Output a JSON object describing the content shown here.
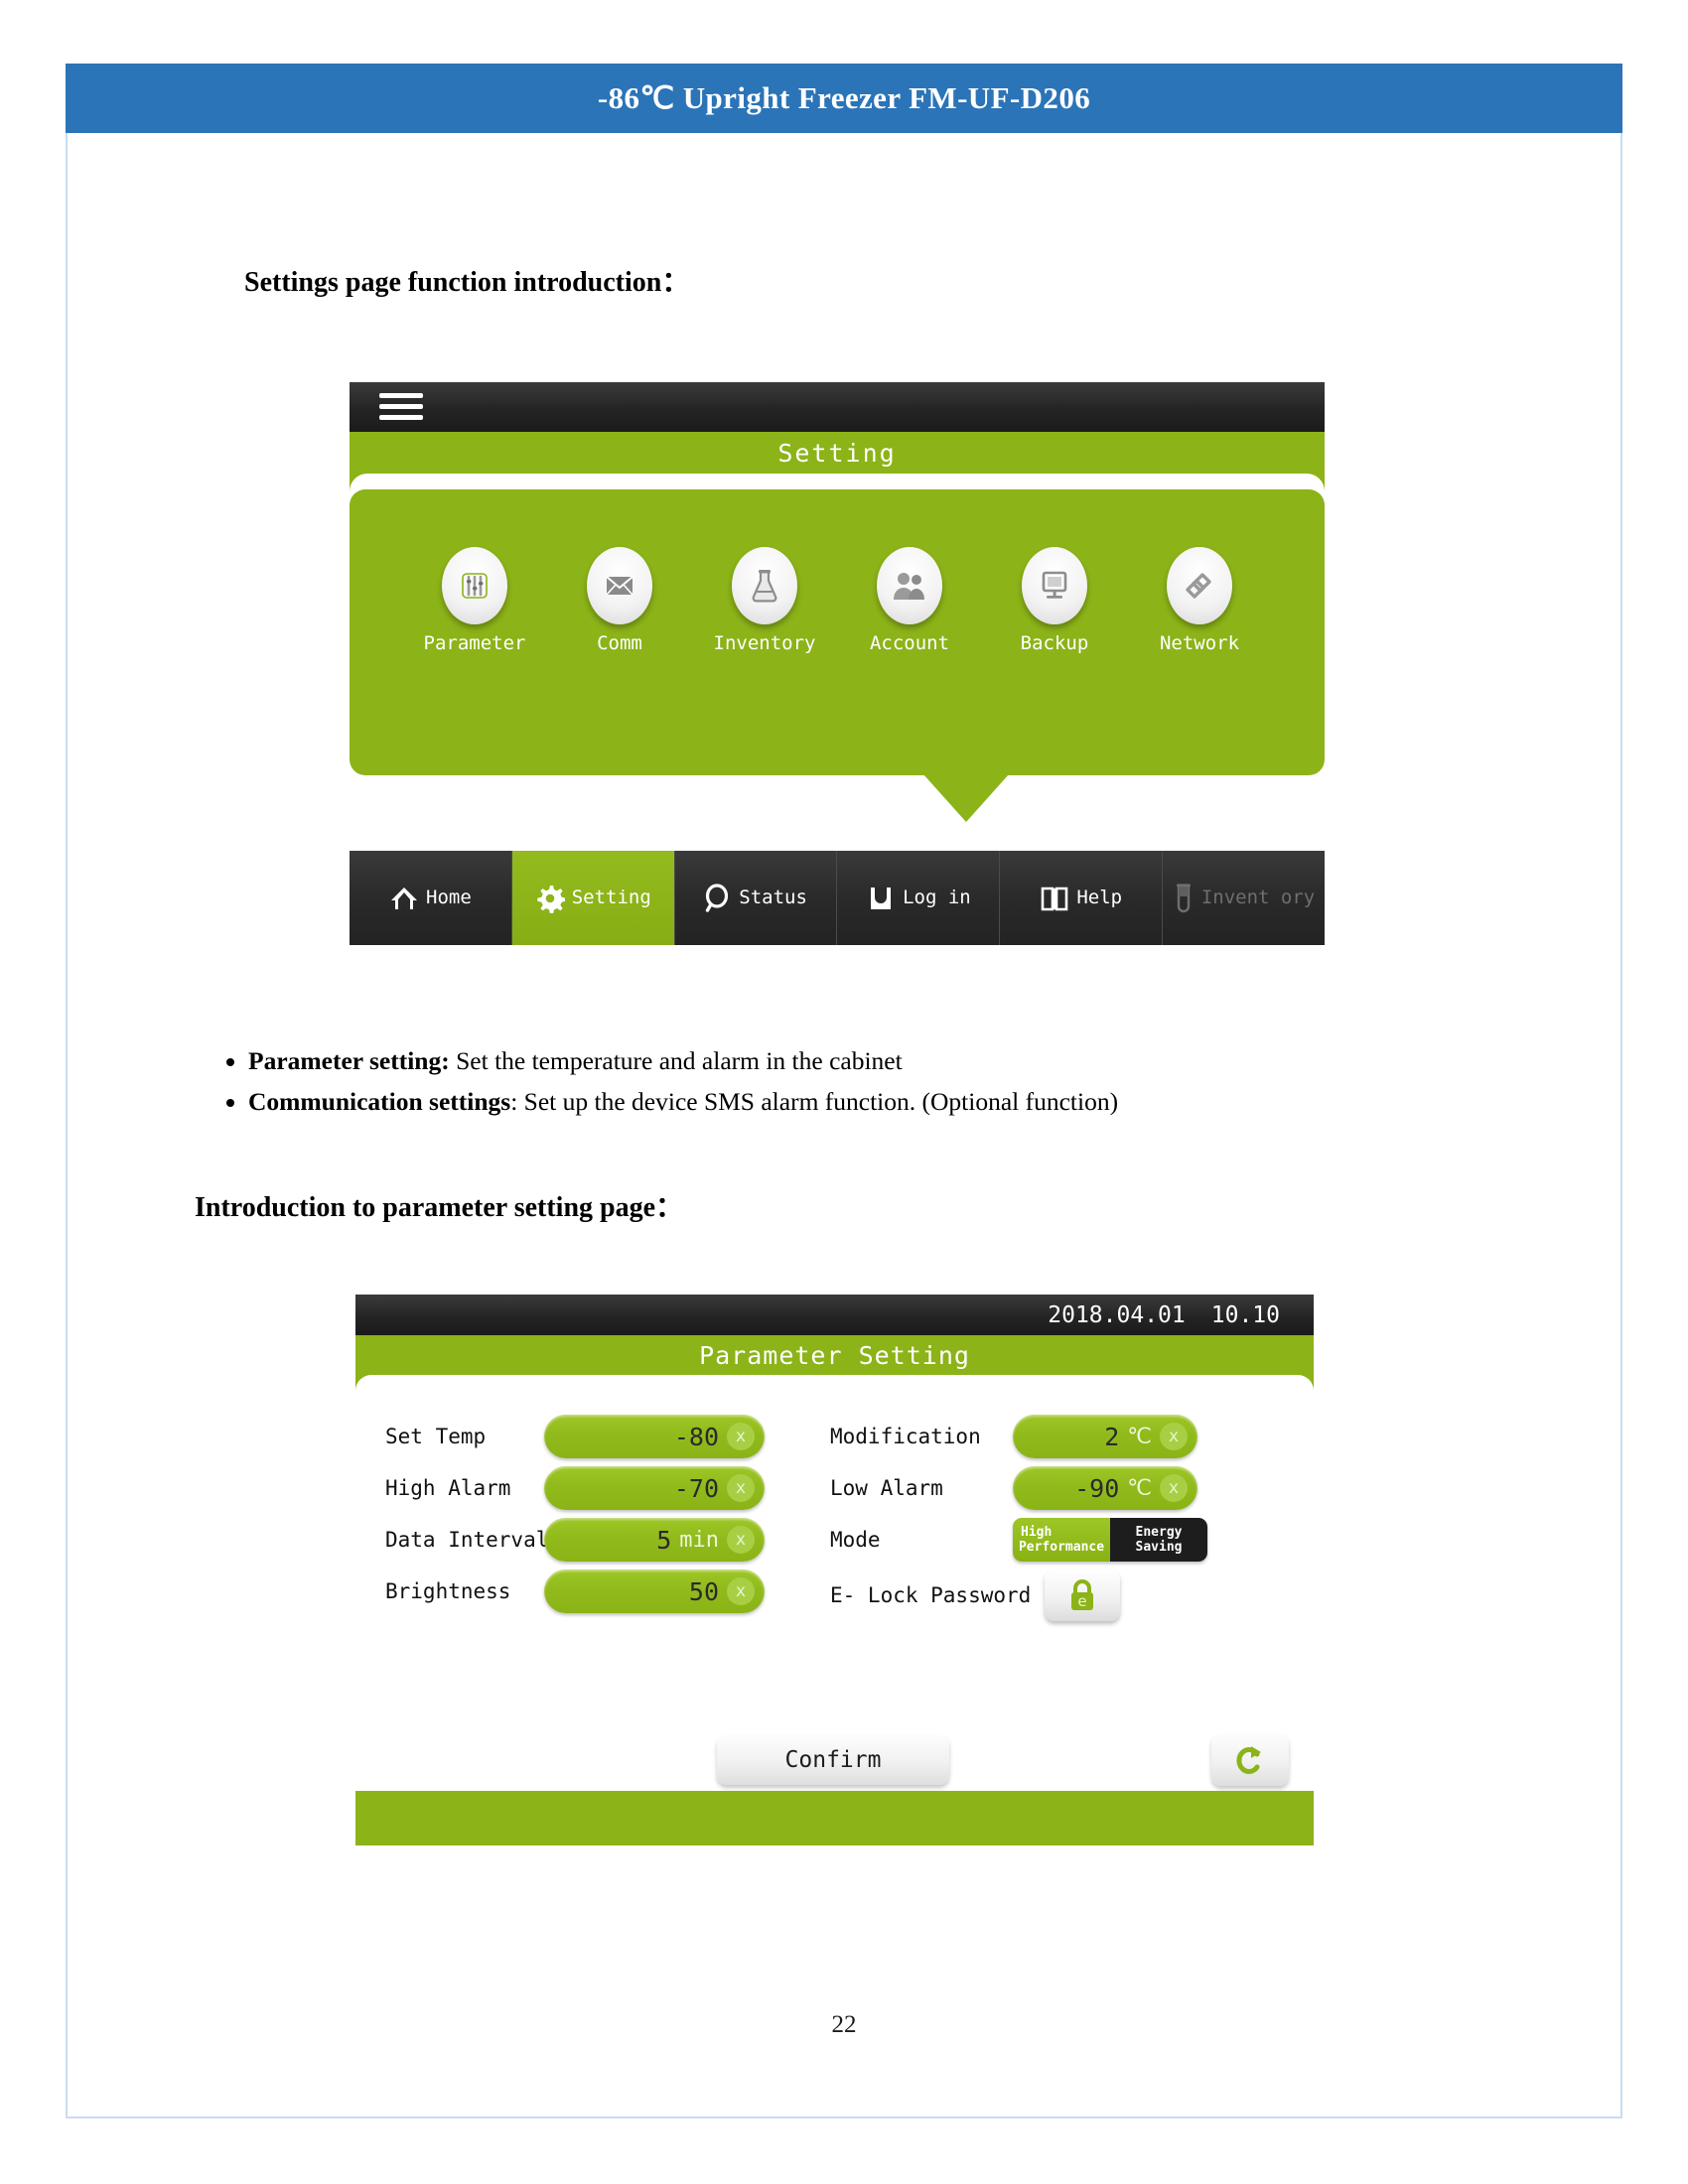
{
  "banner": {
    "title": "-86℃ Upright Freezer FM-UF-D206"
  },
  "headings": {
    "settings_intro": "Settings page function introduction：",
    "parameter_intro": "Introduction to parameter setting page："
  },
  "bullets": [
    {
      "term": "Parameter setting:",
      "desc": " Set the temperature and alarm in the cabinet"
    },
    {
      "term": "Communication settings",
      "desc": ": Set up the device SMS alarm function. (Optional function)"
    }
  ],
  "page_number": "22",
  "colors": {
    "banner_blue": "#2b74b8",
    "accent_green": "#8cb318",
    "dark_bar": "#242424",
    "border_blue": "#c9dcf0"
  },
  "setting_screen": {
    "menu_icon": "hamburger-icon",
    "title": "Setting",
    "tiles": [
      {
        "label": "Parameter",
        "icon": "sliders-icon"
      },
      {
        "label": "Comm",
        "icon": "envelope-icon"
      },
      {
        "label": "Inventory",
        "icon": "flask-icon"
      },
      {
        "label": "Account",
        "icon": "people-icon"
      },
      {
        "label": "Backup",
        "icon": "monitor-icon"
      },
      {
        "label": "Network",
        "icon": "link-icon"
      }
    ],
    "nav": [
      {
        "label": "Home",
        "icon": "home-icon",
        "state": "normal"
      },
      {
        "label": "Setting",
        "icon": "gear-icon",
        "state": "active"
      },
      {
        "label": "Status",
        "icon": "magnifier-icon",
        "state": "normal"
      },
      {
        "label": "Log in",
        "icon": "inbox-icon",
        "state": "normal"
      },
      {
        "label": "Help",
        "icon": "book-icon",
        "state": "normal"
      },
      {
        "label": "Invent ory",
        "icon": "test-tube-icon",
        "state": "disabled"
      }
    ]
  },
  "parameter_screen": {
    "date": "2018.04.01",
    "time": "10.10",
    "title": "Parameter Setting",
    "fields": [
      {
        "label": "Set Temp",
        "value": "-80",
        "unit": "",
        "clear": "x"
      },
      {
        "label": "High Alarm",
        "value": "-70",
        "unit": "",
        "clear": "x"
      },
      {
        "label": "Data Interval",
        "value": "5",
        "unit": "min",
        "clear": "x"
      },
      {
        "label": "Brightness",
        "value": "50",
        "unit": "",
        "clear": "x"
      },
      {
        "label": "Modification",
        "value": "2",
        "unit": "℃",
        "clear": "x"
      },
      {
        "label": "Low Alarm",
        "value": "-90",
        "unit": "℃",
        "clear": "x"
      }
    ],
    "mode": {
      "label": "Mode",
      "option_on_line1": "High",
      "option_on_line2": "Performance",
      "option_off_line1": "Energy",
      "option_off_line2": "Saving",
      "selected": "High Performance"
    },
    "elock": {
      "label": "E- Lock Password",
      "icon": "padlock-e-icon"
    },
    "confirm_label": "Confirm",
    "return_icon": "return-arrow-icon"
  }
}
